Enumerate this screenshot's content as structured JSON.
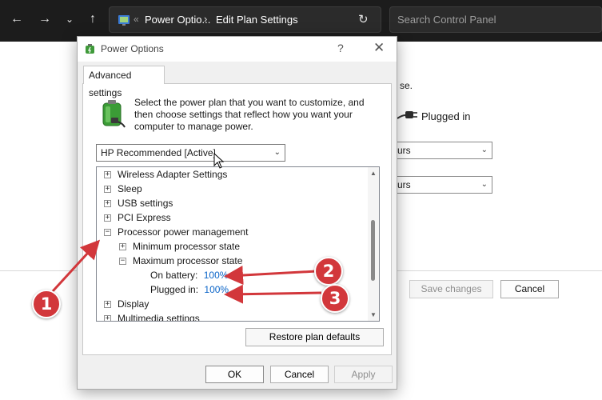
{
  "explorer": {
    "breadcrumb_overflow": "«",
    "breadcrumb": [
      "Power Optio...",
      "Edit Plan Settings"
    ],
    "search_placeholder": "Search Control Panel"
  },
  "background": {
    "partial_text": "se.",
    "plugged_in_label": "Plugged in",
    "select_1_value": "urs",
    "select_2_value": "urs",
    "save_label": "Save changes",
    "cancel_label": "Cancel"
  },
  "dialog": {
    "title": "Power Options",
    "help_glyph": "?",
    "tab_label": "Advanced settings",
    "intro": "Select the power plan that you want to customize, and then choose settings that reflect how you want your computer to manage power.",
    "plan_selected": "HP Recommended [Active]",
    "tree": [
      {
        "label": "Wireless Adapter Settings",
        "toggle": "+"
      },
      {
        "label": "Sleep",
        "toggle": "+"
      },
      {
        "label": "USB settings",
        "toggle": "+"
      },
      {
        "label": "PCI Express",
        "toggle": "+"
      },
      {
        "label": "Processor power management",
        "toggle": "−"
      },
      {
        "label": "Minimum processor state",
        "toggle": "+"
      },
      {
        "label": "Maximum processor state",
        "toggle": "−"
      },
      {
        "label": "On battery:",
        "value": "100%"
      },
      {
        "label": "Plugged in:",
        "value": "100%"
      },
      {
        "label": "Display",
        "toggle": "+"
      },
      {
        "label": "Multimedia settings",
        "toggle": "+"
      }
    ],
    "restore_label": "Restore plan defaults",
    "ok_label": "OK",
    "cancel_label": "Cancel",
    "apply_label": "Apply"
  },
  "annotations": {
    "markers": [
      "1",
      "2",
      "3"
    ],
    "color": "#d2373b"
  }
}
